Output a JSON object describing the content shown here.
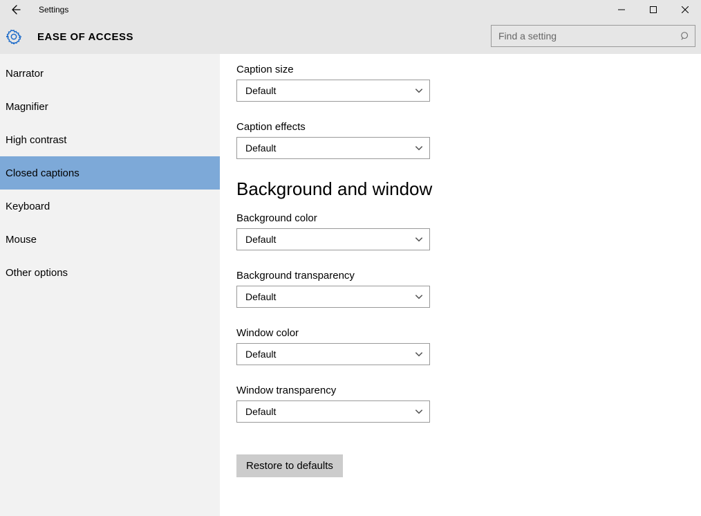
{
  "window": {
    "title": "Settings"
  },
  "header": {
    "page_name": "EASE OF ACCESS"
  },
  "search": {
    "placeholder": "Find a setting"
  },
  "sidebar": {
    "items": [
      {
        "label": "Narrator",
        "selected": false
      },
      {
        "label": "Magnifier",
        "selected": false
      },
      {
        "label": "High contrast",
        "selected": false
      },
      {
        "label": "Closed captions",
        "selected": true
      },
      {
        "label": "Keyboard",
        "selected": false
      },
      {
        "label": "Mouse",
        "selected": false
      },
      {
        "label": "Other options",
        "selected": false
      }
    ]
  },
  "content": {
    "fields_top": [
      {
        "label": "Caption size",
        "value": "Default"
      },
      {
        "label": "Caption effects",
        "value": "Default"
      }
    ],
    "section_heading": "Background and window",
    "fields_bottom": [
      {
        "label": "Background color",
        "value": "Default"
      },
      {
        "label": "Background transparency",
        "value": "Default"
      },
      {
        "label": "Window color",
        "value": "Default"
      },
      {
        "label": "Window transparency",
        "value": "Default"
      }
    ],
    "restore_label": "Restore to defaults"
  }
}
